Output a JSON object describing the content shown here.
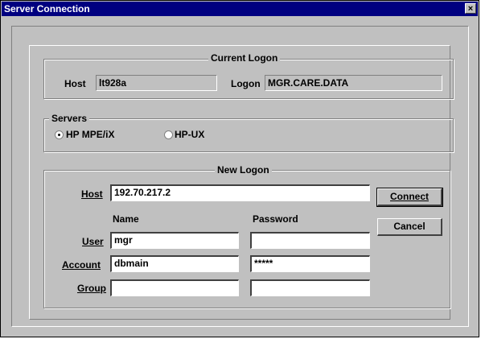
{
  "window": {
    "title": "Server Connection",
    "close_glyph": "×"
  },
  "current_logon": {
    "legend": "Current Logon",
    "host_label": "Host",
    "host_value": "lt928a",
    "logon_label": "Logon",
    "logon_value": "MGR.CARE.DATA"
  },
  "servers": {
    "legend": "Servers",
    "options": [
      {
        "label": "HP MPE/iX",
        "selected": true
      },
      {
        "label": "HP-UX",
        "selected": false
      }
    ]
  },
  "new_logon": {
    "legend": "New Logon",
    "host_label": "Host",
    "host_value": "192.70.217.2",
    "name_header": "Name",
    "password_header": "Password",
    "user_label": "User",
    "user_name": "mgr",
    "user_password": "",
    "account_label": "Account",
    "account_name": "dbmain",
    "account_password": "*****",
    "group_label": "Group",
    "group_name": "",
    "group_password": ""
  },
  "buttons": {
    "connect": "Connect",
    "cancel": "Cancel"
  }
}
